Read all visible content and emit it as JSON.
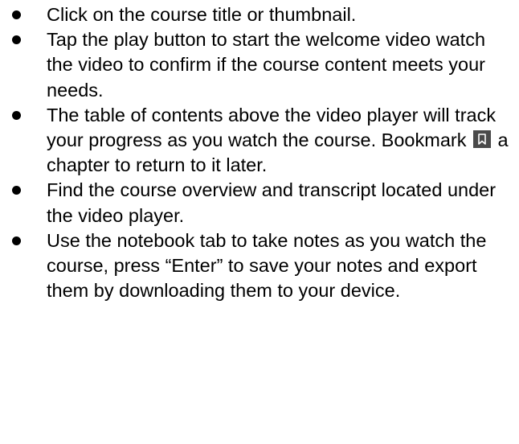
{
  "instructions": {
    "items": [
      {
        "text": "Click on the course title or thumbnail."
      },
      {
        "text": "Tap the play button to start the welcome video watch the video to confirm if the course content meets your needs."
      },
      {
        "text_before_icon": "The table of contents above the video player will track your progress as you watch the course. Bookmark",
        "icon": "bookmark-icon",
        "text_after_icon": "a chapter to return to it later."
      },
      {
        "text": "Find the course overview and transcript located under the video player."
      },
      {
        "text": "Use the notebook tab to take notes as you watch the course, press “Enter” to save your notes and export them by downloading them to your device."
      }
    ]
  }
}
